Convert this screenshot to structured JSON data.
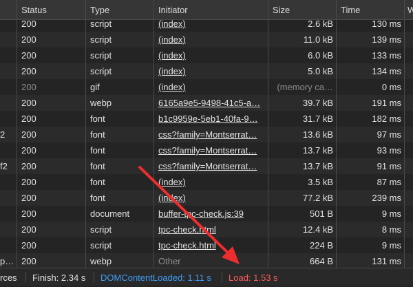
{
  "header": {
    "columns": [
      "Status",
      "Type",
      "Initiator",
      "Size",
      "Time",
      "W"
    ]
  },
  "rows": [
    {
      "name": "",
      "status": "200",
      "type": "script",
      "initiator": "(index)",
      "initiator_link": true,
      "size": "2.6 kB",
      "time": "130 ms",
      "dim": false
    },
    {
      "name": "",
      "status": "200",
      "type": "script",
      "initiator": "(index)",
      "initiator_link": true,
      "size": "11.0 kB",
      "time": "139 ms",
      "dim": false
    },
    {
      "name": "",
      "status": "200",
      "type": "script",
      "initiator": "(index)",
      "initiator_link": true,
      "size": "6.0 kB",
      "time": "133 ms",
      "dim": false
    },
    {
      "name": "",
      "status": "200",
      "type": "script",
      "initiator": "(index)",
      "initiator_link": true,
      "size": "5.0 kB",
      "time": "134 ms",
      "dim": false
    },
    {
      "name": "",
      "status": "200",
      "type": "gif",
      "initiator": "(index)",
      "initiator_link": true,
      "size": "(memory ca…",
      "time": "0 ms",
      "dim": true
    },
    {
      "name": "",
      "status": "200",
      "type": "webp",
      "initiator": "6165a9e5-9498-41c5-a…",
      "initiator_link": true,
      "size": "39.7 kB",
      "time": "191 ms",
      "dim": false
    },
    {
      "name": "",
      "status": "200",
      "type": "font",
      "initiator": "b1c9959e-5eb1-40fa-9…",
      "initiator_link": true,
      "size": "31.7 kB",
      "time": "182 ms",
      "dim": false
    },
    {
      "name": "2",
      "status": "200",
      "type": "font",
      "initiator": "css?family=Montserrat…",
      "initiator_link": true,
      "size": "13.6 kB",
      "time": "97 ms",
      "dim": false
    },
    {
      "name": "",
      "status": "200",
      "type": "font",
      "initiator": "css?family=Montserrat…",
      "initiator_link": true,
      "size": "13.7 kB",
      "time": "93 ms",
      "dim": false
    },
    {
      "name": "f2",
      "status": "200",
      "type": "font",
      "initiator": "css?family=Montserrat…",
      "initiator_link": true,
      "size": "13.7 kB",
      "time": "91 ms",
      "dim": false
    },
    {
      "name": "",
      "status": "200",
      "type": "font",
      "initiator": "(index)",
      "initiator_link": true,
      "size": "3.5 kB",
      "time": "87 ms",
      "dim": false
    },
    {
      "name": "",
      "status": "200",
      "type": "font",
      "initiator": "(index)",
      "initiator_link": true,
      "size": "77.2 kB",
      "time": "239 ms",
      "dim": false
    },
    {
      "name": "",
      "status": "200",
      "type": "document",
      "initiator": "buffer-tpc-check.js:39",
      "initiator_link": true,
      "size": "501 B",
      "time": "9 ms",
      "dim": false
    },
    {
      "name": "",
      "status": "200",
      "type": "script",
      "initiator": "tpc-check.html",
      "initiator_link": true,
      "size": "12.4 kB",
      "time": "8 ms",
      "dim": false
    },
    {
      "name": "",
      "status": "200",
      "type": "script",
      "initiator": "tpc-check.html",
      "initiator_link": true,
      "size": "224 B",
      "time": "9 ms",
      "dim": false
    },
    {
      "name": "p…",
      "status": "200",
      "type": "webp",
      "initiator": "Other",
      "initiator_link": false,
      "size": "664 B",
      "time": "131 ms",
      "dim": false
    }
  ],
  "footer": {
    "resources": "rces",
    "finish": "Finish: 2.34 s",
    "dcl": "DOMContentLoaded: 1.11 s",
    "load": "Load: 1.53 s"
  },
  "colors": {
    "dcl": "#3e9ef5",
    "load": "#ff5c5c",
    "arrow": "#ee2e2e"
  }
}
